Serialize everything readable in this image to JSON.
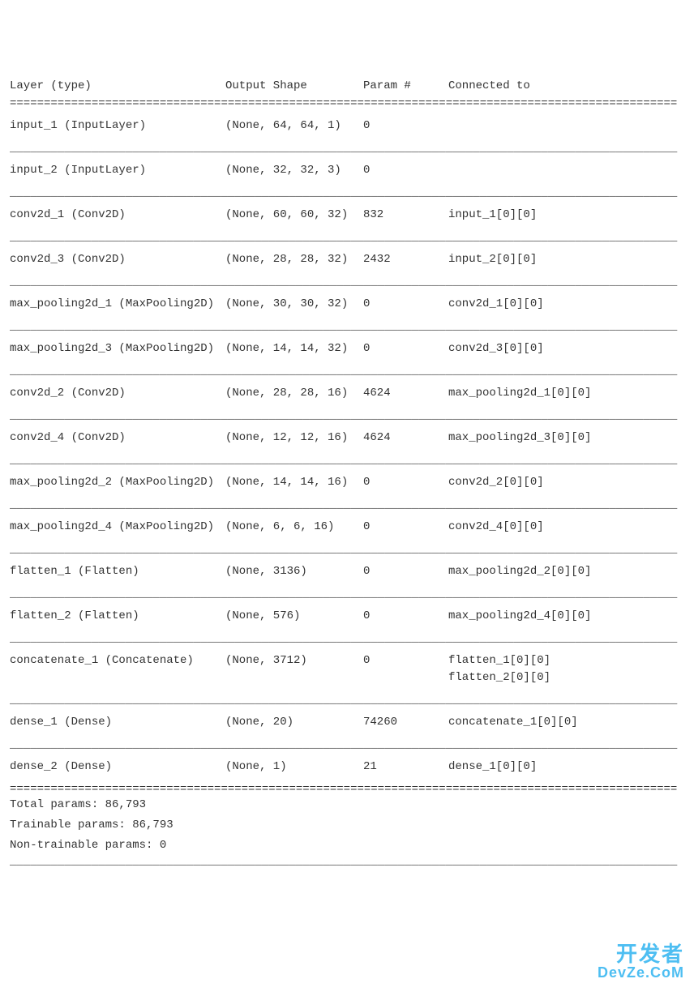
{
  "header": {
    "layer": "Layer (type)",
    "output": "Output Shape",
    "param": "Param #",
    "connected": "Connected to"
  },
  "rows": [
    {
      "layer": "input_1 (InputLayer)",
      "output": "(None, 64, 64, 1)",
      "param": "0",
      "connected": []
    },
    {
      "layer": "input_2 (InputLayer)",
      "output": "(None, 32, 32, 3)",
      "param": "0",
      "connected": []
    },
    {
      "layer": "conv2d_1 (Conv2D)",
      "output": "(None, 60, 60, 32)",
      "param": "832",
      "connected": [
        "input_1[0][0]"
      ]
    },
    {
      "layer": "conv2d_3 (Conv2D)",
      "output": "(None, 28, 28, 32)",
      "param": "2432",
      "connected": [
        "input_2[0][0]"
      ]
    },
    {
      "layer": "max_pooling2d_1 (MaxPooling2D)",
      "output": "(None, 30, 30, 32)",
      "param": "0",
      "connected": [
        "conv2d_1[0][0]"
      ]
    },
    {
      "layer": "max_pooling2d_3 (MaxPooling2D)",
      "output": "(None, 14, 14, 32)",
      "param": "0",
      "connected": [
        "conv2d_3[0][0]"
      ]
    },
    {
      "layer": "conv2d_2 (Conv2D)",
      "output": "(None, 28, 28, 16)",
      "param": "4624",
      "connected": [
        "max_pooling2d_1[0][0]"
      ]
    },
    {
      "layer": "conv2d_4 (Conv2D)",
      "output": "(None, 12, 12, 16)",
      "param": "4624",
      "connected": [
        "max_pooling2d_3[0][0]"
      ]
    },
    {
      "layer": "max_pooling2d_2 (MaxPooling2D)",
      "output": "(None, 14, 14, 16)",
      "param": "0",
      "connected": [
        "conv2d_2[0][0]"
      ]
    },
    {
      "layer": "max_pooling2d_4 (MaxPooling2D)",
      "output": "(None, 6, 6, 16)",
      "param": "0",
      "connected": [
        "conv2d_4[0][0]"
      ]
    },
    {
      "layer": "flatten_1 (Flatten)",
      "output": "(None, 3136)",
      "param": "0",
      "connected": [
        "max_pooling2d_2[0][0]"
      ]
    },
    {
      "layer": "flatten_2 (Flatten)",
      "output": "(None, 576)",
      "param": "0",
      "connected": [
        "max_pooling2d_4[0][0]"
      ]
    },
    {
      "layer": "concatenate_1 (Concatenate)",
      "output": "(None, 3712)",
      "param": "0",
      "connected": [
        "flatten_1[0][0]",
        "flatten_2[0][0]"
      ]
    },
    {
      "layer": "dense_1 (Dense)",
      "output": "(None, 20)",
      "param": "74260",
      "connected": [
        "concatenate_1[0][0]"
      ]
    },
    {
      "layer": "dense_2 (Dense)",
      "output": "(None, 1)",
      "param": "21",
      "connected": [
        "dense_1[0][0]"
      ]
    }
  ],
  "summary": {
    "total": "Total params: 86,793",
    "trainable": "Trainable params: 86,793",
    "non_trainable": "Non-trainable params: 0"
  },
  "divider": {
    "double": "==================================================================================================",
    "single": "__________________________________________________________________________________________________"
  },
  "watermark": {
    "top": "开发者",
    "bottom": "DevZe.CoM"
  }
}
